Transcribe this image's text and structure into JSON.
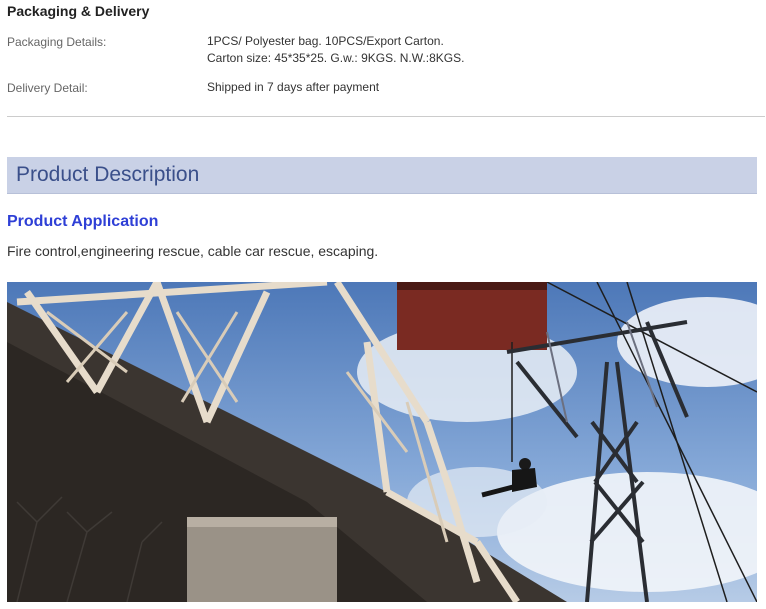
{
  "packaging": {
    "title": "Packaging & Delivery",
    "rows": [
      {
        "label": "Packaging Details:",
        "lines": [
          "1PCS/ Polyester bag. 10PCS/Export Carton.",
          "Carton size: 45*35*25. G.w.: 9KGS. N.W.:8KGS."
        ]
      },
      {
        "label": "Delivery Detail:",
        "lines": [
          "Shipped in 7 days after payment"
        ]
      }
    ]
  },
  "description": {
    "header": "Product Description",
    "application_title": "Product Application",
    "application_text": "Fire control,engineering rescue, cable car rescue, escaping."
  },
  "colors": {
    "band": "#c9d1e6",
    "header_text": "#3a4f8a",
    "application_title": "#2e3fd6"
  }
}
